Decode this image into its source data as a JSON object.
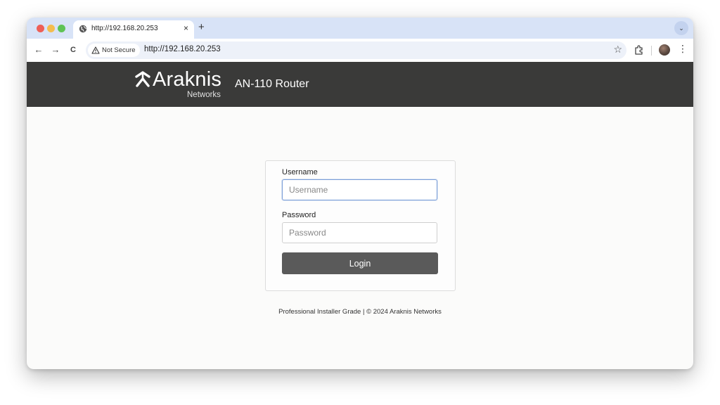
{
  "browser": {
    "tab": {
      "title": "http://192.168.20.253",
      "close_label": "×"
    },
    "new_tab_label": "+",
    "tab_menu_label": "⌄",
    "toolbar": {
      "back_label": "←",
      "forward_label": "→",
      "reload_label": "C",
      "security_chip": "Not Secure",
      "url": "http://192.168.20.253",
      "bookmark_label": "☆",
      "menu_label": "⋮"
    }
  },
  "header": {
    "logo_text": "Araknis",
    "logo_subtext": "Networks",
    "product_name": "AN-110 Router",
    "background": "#3a3a39"
  },
  "login": {
    "username_label": "Username",
    "username_placeholder": "Username",
    "password_label": "Password",
    "password_placeholder": "Password",
    "button_label": "Login"
  },
  "footer": {
    "text": "Professional Installer Grade | © 2024 Araknis Networks"
  },
  "icons": {
    "tab_favicon": "globe-icon",
    "security": "warning-triangle-icon",
    "extensions": "puzzle-icon",
    "logo": "araknis-logo-icon"
  }
}
